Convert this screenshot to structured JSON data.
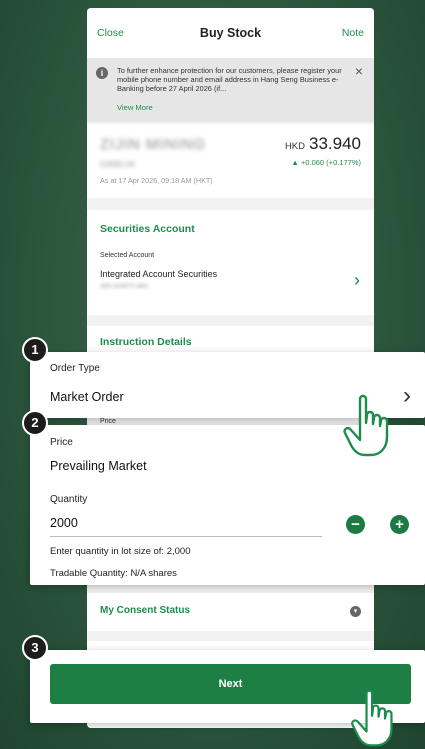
{
  "header": {
    "close_label": "Close",
    "title": "Buy Stock",
    "note_label": "Note"
  },
  "notice": {
    "text": "To further enhance protection for our customers, please register your mobile phone number and email address in Hang Seng Business e-Banking before 27 April 2026 (if...",
    "link": "View More",
    "close_icon": "×"
  },
  "stock": {
    "name": "ZIJIN MINING",
    "code": "02899.HK",
    "timestamp": "As at 17 Apr 2026, 09:18 AM (HKT)",
    "currency": "HKD",
    "price": "33.940",
    "change": "+0.060  (+0.177%)"
  },
  "securities_account": {
    "title": "Securities Account",
    "selected_label": "Selected Account",
    "account_name": "Integrated Account Securities",
    "account_number": "395-543672-883"
  },
  "instruction": {
    "title": "Instruction Details",
    "price_label_small": "Price"
  },
  "step1": {
    "badge": "1",
    "order_type_label": "Order Type",
    "order_type_value": "Market Order"
  },
  "step2": {
    "badge": "2",
    "price_label": "Price",
    "price_value": "Prevailing Market",
    "quantity_label": "Quantity",
    "quantity_value": "2000",
    "lot_hint": "Enter quantity in lot size of: 2,000",
    "tradable": "Tradable Quantity: N/A shares"
  },
  "consent": {
    "title": "My Consent Status"
  },
  "step3": {
    "badge": "3",
    "next_label": "Next"
  },
  "colors": {
    "brand_green": "#1e8c4d",
    "button_green": "#1e7f45"
  }
}
